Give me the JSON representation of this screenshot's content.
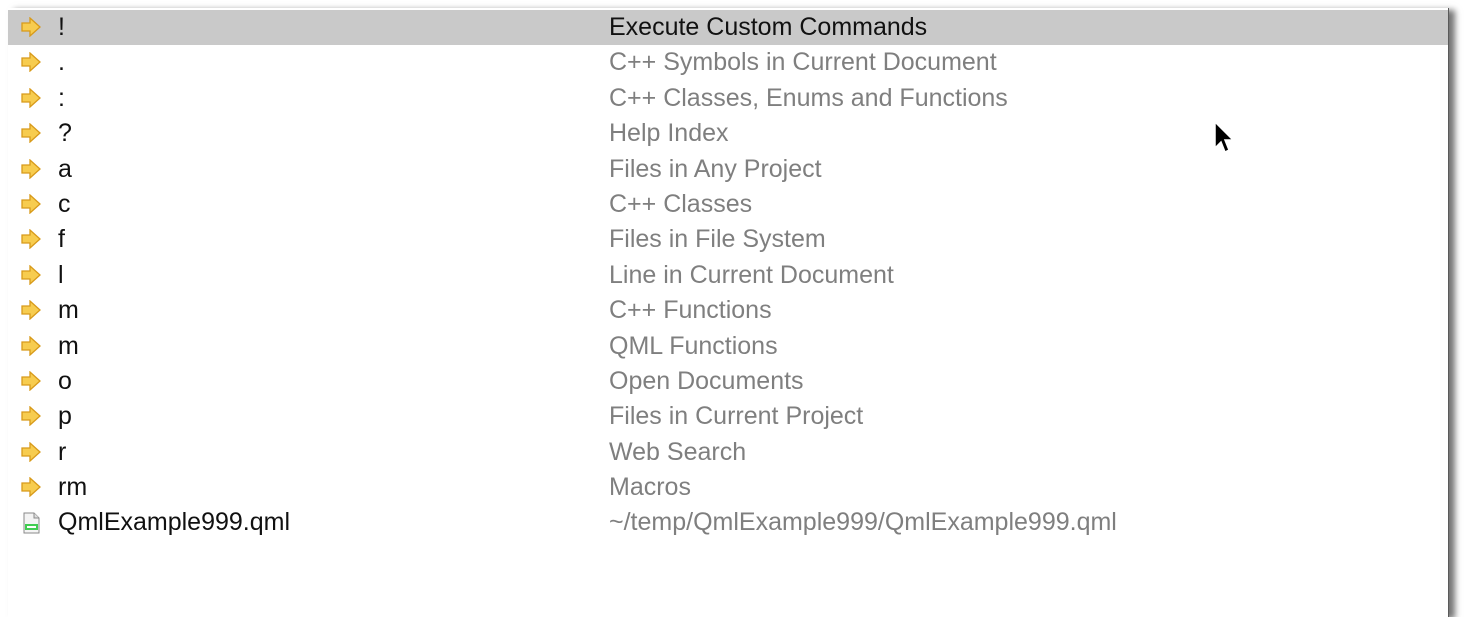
{
  "locator": {
    "items": [
      {
        "shortcut": "!",
        "description": "Execute Custom Commands",
        "icon": "arrow-right-icon",
        "selected": true
      },
      {
        "shortcut": ".",
        "description": "C++ Symbols in Current Document",
        "icon": "arrow-right-icon"
      },
      {
        "shortcut": ":",
        "description": "C++ Classes, Enums and Functions",
        "icon": "arrow-right-icon"
      },
      {
        "shortcut": "?",
        "description": "Help Index",
        "icon": "arrow-right-icon"
      },
      {
        "shortcut": "a",
        "description": "Files in Any Project",
        "icon": "arrow-right-icon"
      },
      {
        "shortcut": "c",
        "description": "C++ Classes",
        "icon": "arrow-right-icon"
      },
      {
        "shortcut": "f",
        "description": "Files in File System",
        "icon": "arrow-right-icon"
      },
      {
        "shortcut": "l",
        "description": "Line in Current Document",
        "icon": "arrow-right-icon"
      },
      {
        "shortcut": "m",
        "description": "C++ Functions",
        "icon": "arrow-right-icon"
      },
      {
        "shortcut": "m",
        "description": "QML Functions",
        "icon": "arrow-right-icon"
      },
      {
        "shortcut": "o",
        "description": "Open Documents",
        "icon": "arrow-right-icon"
      },
      {
        "shortcut": "p",
        "description": "Files in Current Project",
        "icon": "arrow-right-icon"
      },
      {
        "shortcut": "r",
        "description": "Web Search",
        "icon": "arrow-right-icon"
      },
      {
        "shortcut": "rm",
        "description": "Macros",
        "icon": "arrow-right-icon"
      },
      {
        "shortcut": "QmlExample999.qml",
        "description": "~/temp/QmlExample999/QmlExample999.qml",
        "icon": "qml-file-icon"
      }
    ]
  },
  "colors": {
    "selection": "#c9c9c9",
    "arrow_icon": "#f0b82e",
    "description_text": "#7f7f7f",
    "primary_text": "#111111"
  }
}
